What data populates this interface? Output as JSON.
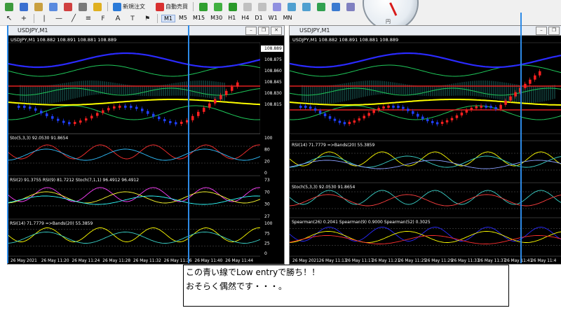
{
  "toolbar": {
    "new_order": "新規注文",
    "auto_trading": "自動売買",
    "timeframes": [
      "M1",
      "M5",
      "M15",
      "M30",
      "H1",
      "H4",
      "D1",
      "W1",
      "MN"
    ],
    "active_timeframe": "M1"
  },
  "globe": {
    "label": "円"
  },
  "left_chart": {
    "window_title": "USDJPY,M1",
    "header": "USDJPY,M1  108.882 108.891 108.881 108.889",
    "price_ticks": [
      "108.889",
      "108.875",
      "108.860",
      "108.845",
      "108.830",
      "108.815"
    ],
    "current_price": "108.889",
    "sub1_label": "Sto(5,3,3) 92.0530 91.8654",
    "sub1_ticks": [
      "100",
      "80",
      "20",
      "0"
    ],
    "sub2_label": "RSI(2) 91.3755  RSI(9) 81.7212  Stoch(7,1,1) 96.4912 96.4912",
    "sub2_ticks": [
      "73",
      "70",
      "30",
      "27"
    ],
    "sub3_label": "RSI(14) 71.7779  =>Bands(20) 55.3859",
    "sub3_ticks": [
      "100",
      "75",
      "25",
      "0"
    ],
    "time_ticks": [
      "26 May 2021",
      "26 May 11:20",
      "26 May 11:24",
      "26 May 11:28",
      "26 May 11:32",
      "26 May 11:36",
      "26 May 11:40",
      "26 May 11:44"
    ]
  },
  "right_chart": {
    "window_title": "USDJPY,M1",
    "header": "USDJPY,M1  108.882 108.891 108.881 108.889",
    "sub1_label": "RSI(14) 71.7779  =>Bands(20) 55.3859",
    "sub2_label": "Stoch(5,3,3) 92.0530 91.8654",
    "sub3_label": "Spearman(26) 0.2041  Spearman(9) 0.9000  Spearman(52) 0.3025",
    "time_ticks": [
      "26 May 2021",
      "26 May 11:13",
      "26 May 11:17",
      "26 May 11:21",
      "26 May 11:25",
      "26 May 11:29",
      "26 May 11:33",
      "26 May 11:37",
      "26 May 11:41",
      "26 May 11:4"
    ]
  },
  "note": {
    "line1": "この青い線でLow entryで勝ち！！",
    "line2": "おそらく偶然です・・・。"
  },
  "colors": {
    "chart_bg": "#000000",
    "bull_candle": "#ff2020",
    "bear_candle": "#2040ff",
    "signal_line": "#2d8ae6",
    "ma_yellow": "#ffff00",
    "ma_blue": "#2a2aff",
    "band_green": "#1fc85a",
    "cloud_cyan": "#3ad1c8"
  }
}
